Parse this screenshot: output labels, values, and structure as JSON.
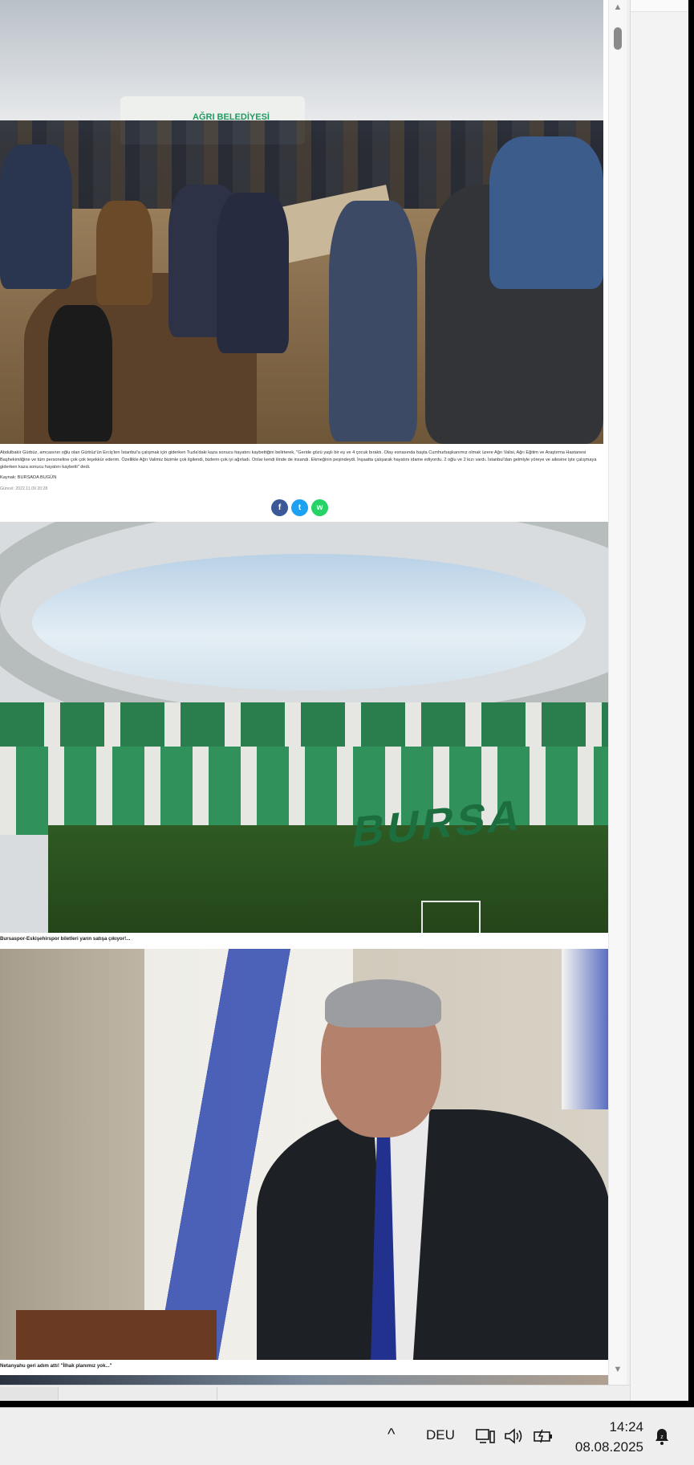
{
  "caption_block": {
    "body": "Abdulbakir Gürbüz, amcasının oğlu olan Gürbüz'ün Erciş'ten İstanbul'a çalışmak için giderken Tuzla'daki kaza sonucu hayatını kaybettiğini belirterek, \"Geride gözü yaşlı bir eş ve 4 çocuk bıraktı. Olay esnasında başta Cumhurbaşkanımız olmak üzere Ağrı Valisi, Ağrı Eğitim ve Araştırma Hastanesi Başhekimliğine ve tüm personeline çok çok teşekkür ederim. Özellikle Ağrı Valimiz bizimle çok ilgilendi, bizlerin çok iyi ağırladı. Onlar kendi ilinde de insandı. Ekmeğinin peşindeydi. İnşaatta çalışarak hayatını idame ediyordu. 2 oğlu ve 2 kızı vardı. İstanbul'dan gelmiyle yöreye ve ailesine işte çalışmaya giderken kaza sonucu hayatını kaybetti\" dedi.",
    "source": "Kaynak: BURSADA BUGÜN",
    "date": "Güncel: 2022.11.09 20:28"
  },
  "share": {
    "facebook": "f",
    "twitter": "t",
    "whatsapp": "w"
  },
  "funeral_photo": {
    "van_text": "AĞRI BELEDİYESİ"
  },
  "stadium_photo": {
    "stand_text": "BURSA"
  },
  "captions": {
    "stadium": "Bursaspor-Eskişehirspor biletleri yarın satışa çıkıyor!...",
    "portrait": "Netanyahu geri adım attı! \"İlhak planımız yok...\""
  },
  "scrollbar": {
    "up_arrow": "▲",
    "down_arrow": "▼"
  },
  "taskbar": {
    "chevron": "^",
    "language": "DEU",
    "time": "14:24",
    "date": "08.08.2025"
  },
  "colors": {
    "facebook": "#3b5998",
    "twitter": "#1da1f2",
    "whatsapp": "#25d366"
  },
  "icons": [
    "network-icon",
    "volume-icon",
    "battery-icon",
    "notification-icon"
  ]
}
